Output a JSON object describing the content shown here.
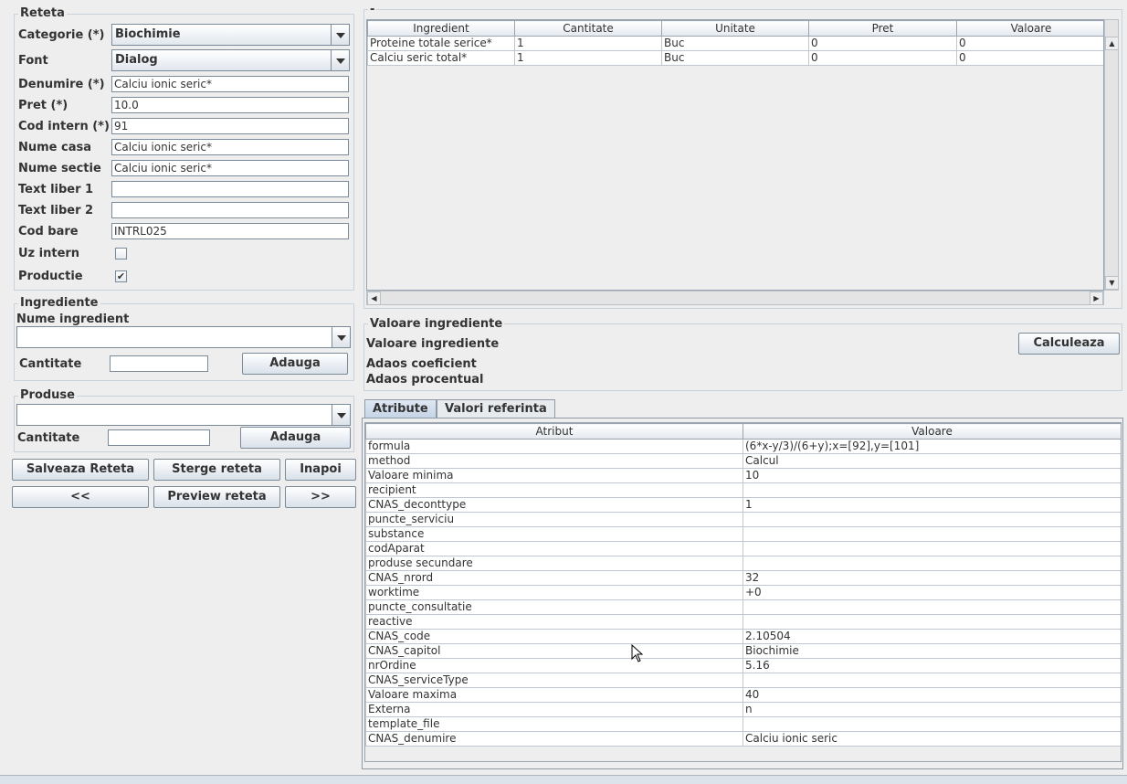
{
  "reteta": {
    "title": "Reteta",
    "categorie_label": "Categorie (*)",
    "categorie_value": "Biochimie",
    "font_label": "Font",
    "font_value": "Dialog",
    "denumire_label": "Denumire (*)",
    "denumire_value": "Calciu ionic seric*",
    "pret_label": "Pret (*)",
    "pret_value": "10.0",
    "cod_intern_label": "Cod intern (*)",
    "cod_intern_value": "91",
    "nume_casa_label": "Nume casa",
    "nume_casa_value": "Calciu ionic seric*",
    "nume_sectie_label": "Nume sectie",
    "nume_sectie_value": "Calciu ionic seric*",
    "text_liber1_label": "Text liber 1",
    "text_liber1_value": "",
    "text_liber2_label": "Text liber 2",
    "text_liber2_value": "",
    "cod_bare_label": "Cod bare",
    "cod_bare_value": "INTRL025",
    "uz_intern_label": "Uz intern",
    "uz_intern_checked": false,
    "productie_label": "Productie",
    "productie_checked": true
  },
  "ingrediente": {
    "title": "Ingrediente",
    "nume_label": "Nume ingredient",
    "cantitate_label": "Cantitate",
    "adauga_label": "Adauga"
  },
  "produse": {
    "title": "Produse",
    "cantitate_label": "Cantitate",
    "adauga_label": "Adauga"
  },
  "buttons": {
    "salveaza": "Salveaza Reteta",
    "sterge": "Sterge reteta",
    "inapoi": "Inapoi",
    "prev": "<<",
    "preview": "Preview reteta",
    "next": ">>"
  },
  "ingredients_table": {
    "group_title": "-",
    "columns": [
      "Ingredient",
      "Cantitate",
      "Unitate",
      "Pret",
      "Valoare"
    ],
    "rows": [
      [
        "Proteine totale serice*",
        "1",
        "Buc",
        "0",
        "0"
      ],
      [
        "Calciu seric total*",
        "1",
        "Buc",
        "0",
        "0"
      ]
    ]
  },
  "valoare": {
    "title": "Valoare ingrediente",
    "valoare_label": "Valoare ingrediente",
    "adaos_coef_label": "Adaos coeficient",
    "adaos_proc_label": "Adaos procentual",
    "calculeaza_label": "Calculeaza"
  },
  "tabs": [
    "Atribute",
    "Valori referinta"
  ],
  "attributes": {
    "columns": [
      "Atribut",
      "Valoare"
    ],
    "rows": [
      [
        "formula",
        "(6*x-y/3)/(6+y);x=[92],y=[101]"
      ],
      [
        "method",
        "Calcul"
      ],
      [
        "Valoare minima",
        "10"
      ],
      [
        "recipient",
        ""
      ],
      [
        "CNAS_deconttype",
        "1"
      ],
      [
        "puncte_serviciu",
        ""
      ],
      [
        "substance",
        ""
      ],
      [
        "codAparat",
        ""
      ],
      [
        "produse secundare",
        ""
      ],
      [
        "CNAS_nrord",
        "32"
      ],
      [
        "worktime",
        "+0"
      ],
      [
        "puncte_consultatie",
        ""
      ],
      [
        "reactive",
        ""
      ],
      [
        "CNAS_code",
        "2.10504"
      ],
      [
        "CNAS_capitol",
        "Biochimie"
      ],
      [
        "nrOrdine",
        "5.16"
      ],
      [
        "CNAS_serviceType",
        ""
      ],
      [
        "Valoare maxima",
        "40"
      ],
      [
        "Externa",
        "n"
      ],
      [
        "template_file",
        ""
      ],
      [
        "CNAS_denumire",
        "Calciu ionic seric"
      ]
    ]
  }
}
